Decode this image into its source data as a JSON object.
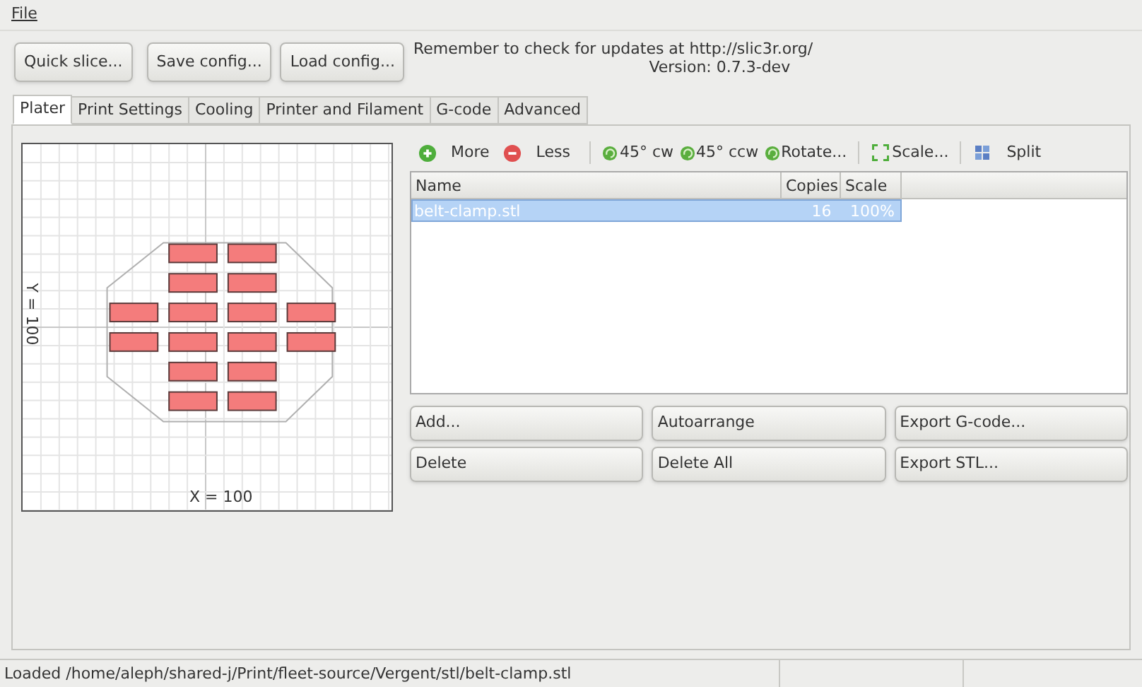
{
  "menu": [
    "File"
  ],
  "toolbar": {
    "buttons": [
      "Quick slice...",
      "Save config...",
      "Load config..."
    ],
    "notice": "Remember to check for updates at http://slic3r.org/",
    "version": "Version: 0.7.3-dev"
  },
  "tabs": [
    {
      "label": "Plater",
      "selected": true
    },
    {
      "label": "Print Settings",
      "selected": false
    },
    {
      "label": "Cooling",
      "selected": false
    },
    {
      "label": "Printer and Filament",
      "selected": false
    },
    {
      "label": "G-code",
      "selected": false
    },
    {
      "label": "Advanced",
      "selected": false
    }
  ],
  "plater": {
    "x_label": "X = 100",
    "y_label": "Y = 100"
  },
  "actions": [
    {
      "kind": "add",
      "label": "More"
    },
    {
      "kind": "remove",
      "label": "Less"
    },
    {
      "kind": "separator"
    },
    {
      "kind": "rotate",
      "label": "45° cw"
    },
    {
      "kind": "rotate",
      "label": "45° ccw"
    },
    {
      "kind": "rotate",
      "label": "Rotate..."
    },
    {
      "kind": "separator"
    },
    {
      "kind": "scale",
      "label": "Scale..."
    },
    {
      "kind": "separator"
    },
    {
      "kind": "split",
      "label": "Split"
    }
  ],
  "table": {
    "columns": [
      "Name",
      "Copies",
      "Scale"
    ],
    "rows": [
      {
        "name": "belt-clamp.stl",
        "copies": "16",
        "scale": "100%",
        "selected": true
      }
    ]
  },
  "buttons": [
    [
      "Add...",
      "Autoarrange",
      "Export G-code..."
    ],
    [
      "Delete",
      "Delete All",
      "Export STL..."
    ]
  ],
  "status_bar": "Loaded /home/aleph/shared-j/Print/fleet-source/Vergent/stl/belt-clamp.stl"
}
